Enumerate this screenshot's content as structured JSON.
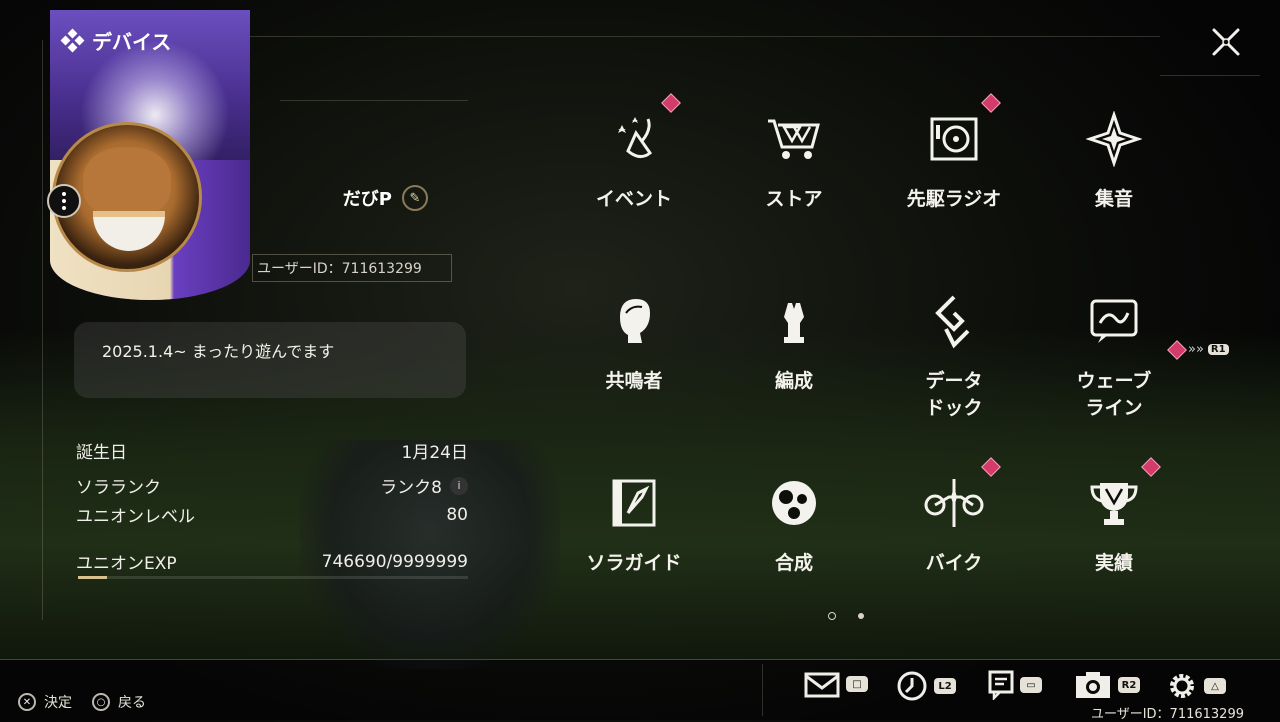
{
  "header": {
    "title": "デバイス"
  },
  "profile": {
    "username": "だびP",
    "user_id": "ユーザーID：711613299",
    "bio": "2025.1.4~ まったり遊んでます",
    "stats": [
      {
        "label": "誕生日",
        "value": "1月24日"
      },
      {
        "label": "ソラランク",
        "value": "ランク8"
      },
      {
        "label": "ユニオンレベル",
        "value": "80"
      }
    ],
    "exp": {
      "label": "ユニオンEXP",
      "value": "746690/9999999",
      "fraction": 0.0747
    }
  },
  "menu": [
    {
      "label": "イベント",
      "alert": true
    },
    {
      "label": "ストア",
      "alert": false
    },
    {
      "label": "先駆ラジオ",
      "alert": true
    },
    {
      "label": "集音",
      "alert": false
    },
    {
      "label": "共鳴者",
      "alert": false
    },
    {
      "label": "編成",
      "alert": false
    },
    {
      "label": "データ\nドック",
      "alert": false
    },
    {
      "label": "ウェーブ\nライン",
      "alert": false
    },
    {
      "label": "ソラガイド",
      "alert": false
    },
    {
      "label": "合成",
      "alert": false
    },
    {
      "label": "バイク",
      "alert": true
    },
    {
      "label": "実績",
      "alert": true
    }
  ],
  "nav_hint": {
    "button": "R1"
  },
  "footer": {
    "confirm": "決定",
    "back": "戻る",
    "shortcuts": [
      {
        "icon": "mail-icon",
        "button": "□"
      },
      {
        "icon": "clock-icon",
        "button": "L2"
      },
      {
        "icon": "notes-icon",
        "button": "▭"
      },
      {
        "icon": "camera-icon",
        "button": "R2"
      },
      {
        "icon": "settings-icon",
        "button": "△"
      }
    ],
    "user_id": "ユーザーID：711613299"
  },
  "colors": {
    "accent": "#d7c28f",
    "alert": "#d23b6a",
    "card_purple": "#5a2fb0"
  }
}
